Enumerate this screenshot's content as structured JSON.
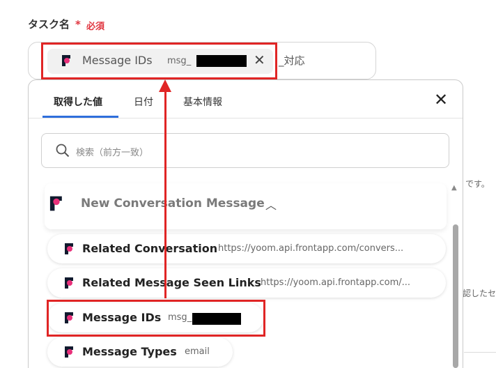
{
  "form": {
    "label": "タスク名",
    "required_star": "*",
    "required_text": "必須",
    "suffix": "_対応",
    "chip": {
      "name": "Message IDs",
      "value_prefix": "msg_"
    }
  },
  "panel": {
    "tabs": [
      {
        "label": "取得した値",
        "active": true
      },
      {
        "label": "日付",
        "active": false
      },
      {
        "label": "基本情報",
        "active": false
      }
    ],
    "search_placeholder": "検索（前方一致）",
    "section": {
      "title": "New Conversation Message"
    },
    "items": [
      {
        "name": "Related Conversation",
        "value": "https://yoom.api.frontapp.com/convers..."
      },
      {
        "name": "Related Message Seen Links",
        "value": "https://yoom.api.frontapp.com/..."
      },
      {
        "name": "Message IDs",
        "value": "msg_"
      },
      {
        "name": "Message Types",
        "value": "email"
      }
    ]
  },
  "background": {
    "text1": "です。",
    "text2": "認したセ"
  },
  "colors": {
    "accent_red": "#e02525",
    "brand_pink": "#e8307a",
    "brand_dark": "#111a2e",
    "tab_active": "#2f6fdc"
  },
  "icons": [
    "front-logo-icon",
    "close-icon",
    "search-icon",
    "chevron-up-icon"
  ]
}
